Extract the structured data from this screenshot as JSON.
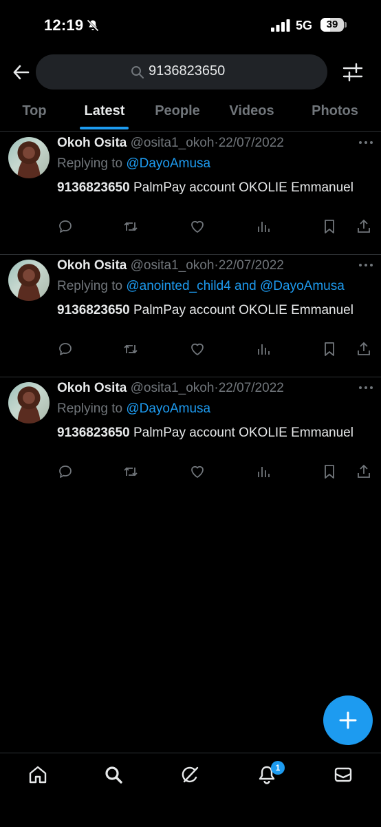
{
  "status_bar": {
    "time": "12:19",
    "network": "5G",
    "battery": "39"
  },
  "search": {
    "query": "9136823650"
  },
  "tabs": [
    {
      "label": "Top",
      "active": false
    },
    {
      "label": "Latest",
      "active": true
    },
    {
      "label": "People",
      "active": false
    },
    {
      "label": "Videos",
      "active": false
    },
    {
      "label": "Photos",
      "active": false
    }
  ],
  "tweets": [
    {
      "name": "Okoh Osita",
      "handle": "@osita1_okoh",
      "sep": "·",
      "date": "22/07/2022",
      "reply_prefix": "Replying to ",
      "reply_to": "@DayoAmusa",
      "number": "9136823650",
      "text": " PalmPay account OKOLIE Emmanuel"
    },
    {
      "name": "Okoh Osita",
      "handle": "@osita1_okoh",
      "sep": "·",
      "date": "22/07/2022",
      "reply_prefix": "Replying to ",
      "reply_to": "@anointed_child4 and @DayoAmusa",
      "number": "9136823650",
      "text": " PalmPay account OKOLIE Emmanuel"
    },
    {
      "name": "Okoh Osita",
      "handle": "@osita1_okoh",
      "sep": "·",
      "date": "22/07/2022",
      "reply_prefix": "Replying to ",
      "reply_to": "@DayoAmusa",
      "number": "9136823650",
      "text": " PalmPay account OKOLIE Emmanuel"
    }
  ],
  "bottom_nav": {
    "items": [
      "home-icon",
      "search-icon",
      "grok-icon",
      "notifications-icon",
      "messages-icon"
    ],
    "notification_badge": "1"
  },
  "colors": {
    "accent": "#1d9bf0",
    "muted": "#71767b",
    "divider": "#2f3336",
    "background": "#000000"
  }
}
